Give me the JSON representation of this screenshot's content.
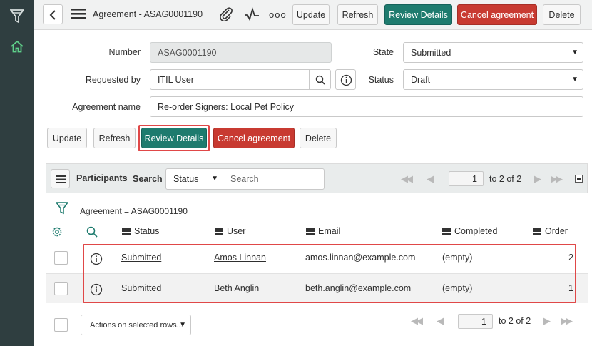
{
  "icons": {
    "filter": "filter-funnel-icon",
    "home": "home-icon",
    "back": "chevron-left-icon",
    "menu": "hamburger-menu-icon",
    "attach": "paperclip-icon",
    "activity": "activity-pulse-icon",
    "more": "more-options-icon",
    "search": "magnifier-icon",
    "info": "info-circle-icon",
    "settings": "gear-icon",
    "collapse": "collapse-box-icon"
  },
  "colors": {
    "primary": "#1e7b6e",
    "danger": "#c83a31",
    "highlight": "#e04848",
    "nav": "#2f3e40"
  },
  "header": {
    "title": "Agreement - ASAG0001190",
    "more_label": "ooo",
    "buttons": {
      "update": "Update",
      "refresh": "Refresh",
      "review": "Review Details",
      "cancel": "Cancel agreement",
      "delete": "Delete"
    }
  },
  "form": {
    "number_label": "Number",
    "number_value": "ASAG0001190",
    "state_label": "State",
    "state_value": "Submitted",
    "requested_by_label": "Requested by",
    "requested_by_value": "ITIL User",
    "status_label": "Status",
    "status_value": "Draft",
    "agreement_name_label": "Agreement name",
    "agreement_name_value": "Re-order Signers: Local Pet Policy",
    "select_caret": "▼"
  },
  "form_buttons": {
    "update": "Update",
    "refresh": "Refresh",
    "review": "Review Details",
    "cancel": "Cancel agreement",
    "delete": "Delete"
  },
  "list": {
    "title": "Participants",
    "search_label": "Search",
    "search_field": "Status",
    "search_placeholder": "Search",
    "page_value": "1",
    "page_text": "to 2 of 2",
    "filter_text": "Agreement = ASAG0001190",
    "columns": [
      "Status",
      "User",
      "Email",
      "Completed",
      "Order"
    ],
    "rows": [
      {
        "status": "Submitted",
        "user": "Amos Linnan",
        "email": "amos.linnan@example.com",
        "completed": "(empty)",
        "order": "2"
      },
      {
        "status": "Submitted",
        "user": "Beth Anglin",
        "email": "beth.anglin@example.com",
        "completed": "(empty)",
        "order": "1"
      }
    ]
  },
  "footer": {
    "actions_label": "Actions on selected rows...",
    "page_value": "1",
    "page_text": "to 2 of 2"
  }
}
